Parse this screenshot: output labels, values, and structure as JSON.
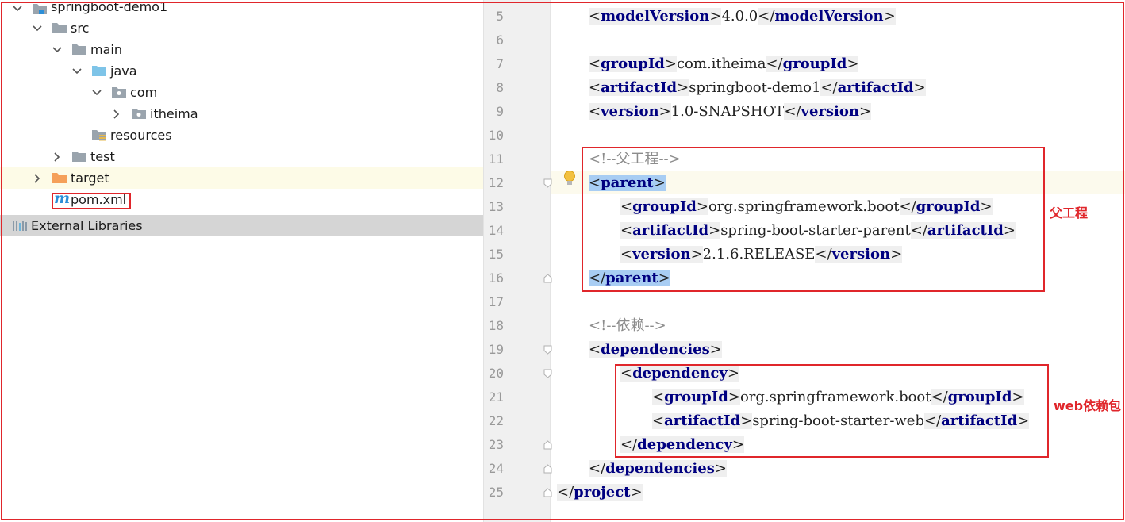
{
  "tree": {
    "project": "springboot-demo1",
    "src": "src",
    "main": "main",
    "java": "java",
    "com": "com",
    "itheima": "itheima",
    "resources": "resources",
    "test": "test",
    "target": "target",
    "pom": "pom.xml",
    "external_libraries": "External Libraries"
  },
  "editor": {
    "line_numbers": [
      "5",
      "6",
      "7",
      "8",
      "9",
      "10",
      "11",
      "12",
      "13",
      "14",
      "15",
      "16",
      "17",
      "18",
      "19",
      "20",
      "21",
      "22",
      "23",
      "24",
      "25"
    ],
    "modelVersion": "4.0.0",
    "groupId": "com.itheima",
    "artifactId": "springboot-demo1",
    "version": "1.0-SNAPSHOT",
    "comment_parent": "<!--父工程-->",
    "parent_groupId": "org.springframework.boot",
    "parent_artifactId": "spring-boot-starter-parent",
    "parent_version": "2.1.6.RELEASE",
    "comment_deps": "<!--依赖-->",
    "dep_groupId": "org.springframework.boot",
    "dep_artifactId": "spring-boot-starter-web",
    "tags": {
      "modelVersion": "modelVersion",
      "groupId": "groupId",
      "artifactId": "artifactId",
      "version": "version",
      "parent": "parent",
      "dependencies": "dependencies",
      "dependency": "dependency",
      "project": "project"
    }
  },
  "annotations": {
    "parent_label": "父工程",
    "web_label": "web依赖包"
  },
  "colors": {
    "annotation_red": "#e0262b",
    "tag_name": "#000080",
    "selection": "#a8cdf3",
    "folder_blue": "#7ec4e8",
    "folder_orange": "#f5a05a",
    "maven_blue": "#2c8fd8"
  }
}
